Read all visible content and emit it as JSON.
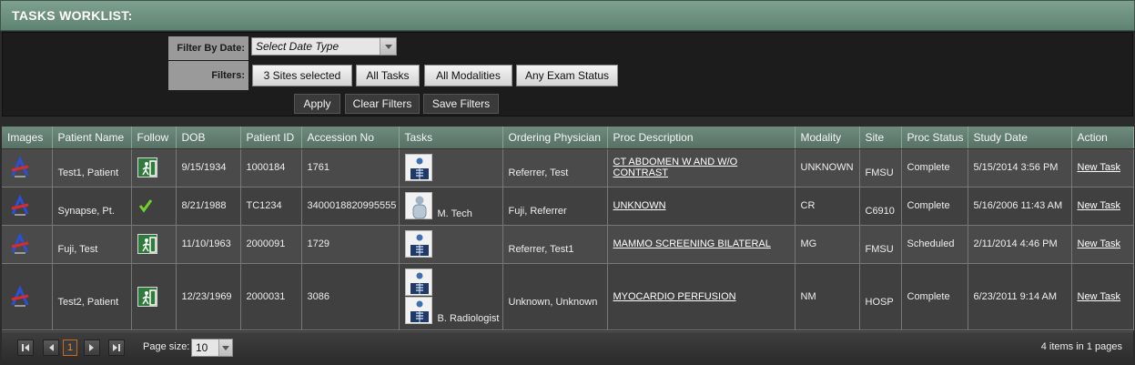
{
  "title": "TASKS WORKLIST:",
  "filters": {
    "date_label": "Filter By Date:",
    "date_value": "Select Date Type",
    "filters_label": "Filters:",
    "sites": "3 Sites selected",
    "tasks": "All Tasks",
    "modalities": "All Modalities",
    "exam_status": "Any Exam Status",
    "apply": "Apply",
    "clear": "Clear Filters",
    "save": "Save Filters"
  },
  "columns": [
    "Images",
    "Patient Name",
    "Follow",
    "DOB",
    "Patient ID",
    "Accession No",
    "Tasks",
    "Ordering Physician",
    "Proc Description",
    "Modality",
    "Site",
    "Proc Status",
    "Study Date",
    "Action"
  ],
  "rows": [
    {
      "patient": "Test1, Patient",
      "follow": "exit-icon",
      "dob": "9/15/1934",
      "pid": "1000184",
      "accession": "1761",
      "task_thumbs": [
        "xray-icon"
      ],
      "task_who": "",
      "physician": "Referrer, Test",
      "proc": "CT ABDOMEN W AND W/O CONTRAST",
      "modality": "UNKNOWN",
      "site": "FMSU",
      "status": "Complete",
      "study_date": "5/15/2014 3:56 PM",
      "action": "New Task"
    },
    {
      "patient": "Synapse, Pt.",
      "follow": "check-icon",
      "dob": "8/21/1988",
      "pid": "TC1234",
      "accession": "3400018820995555",
      "task_thumbs": [
        "person-icon"
      ],
      "task_who": "M. Tech",
      "physician": "Fuji, Referrer",
      "proc": "UNKNOWN",
      "modality": "CR",
      "site": "C6910",
      "status": "Complete",
      "study_date": "5/16/2006 11:43 AM",
      "action": "New Task"
    },
    {
      "patient": "Fuji, Test",
      "follow": "exit-icon",
      "dob": "11/10/1963",
      "pid": "2000091",
      "accession": "1729",
      "task_thumbs": [
        "xray-icon"
      ],
      "task_who": "",
      "physician": "Referrer, Test1",
      "proc": "MAMMO SCREENING BILATERAL",
      "modality": "MG",
      "site": "FMSU",
      "status": "Scheduled",
      "study_date": "2/11/2014 4:46 PM",
      "action": "New Task"
    },
    {
      "patient": "Test2, Patient",
      "follow": "exit-icon",
      "dob": "12/23/1969",
      "pid": "2000031",
      "accession": "3086",
      "task_thumbs": [
        "xray-icon",
        "xray-icon"
      ],
      "task_who": "B. Radiologist",
      "physician": "Unknown, Unknown",
      "proc": "MYOCARDIO PERFUSION",
      "modality": "NM",
      "site": "HOSP",
      "status": "Complete",
      "study_date": "6/23/2011 9:14 AM",
      "action": "New Task"
    }
  ],
  "pager": {
    "current_page": "1",
    "page_size_label": "Page size:",
    "page_size": "10",
    "info": "4 items in 1 pages"
  }
}
